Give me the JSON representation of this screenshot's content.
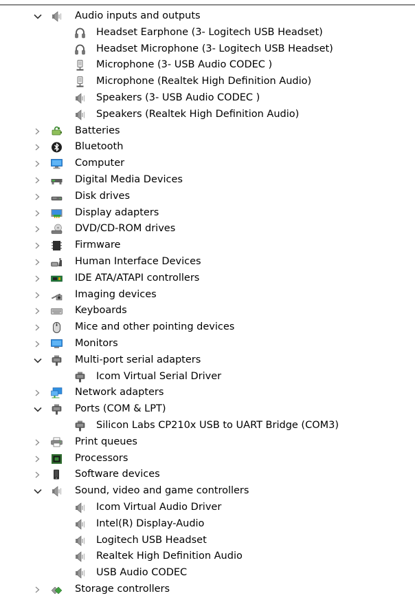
{
  "tree": [
    {
      "type": "category",
      "label": "Audio inputs and outputs",
      "expanded": true,
      "icon": "speaker-icon"
    },
    {
      "type": "device",
      "label": "Headset Earphone (3- Logitech USB Headset)",
      "icon": "headset-icon"
    },
    {
      "type": "device",
      "label": "Headset Microphone (3- Logitech USB Headset)",
      "icon": "headset-icon"
    },
    {
      "type": "device",
      "label": "Microphone (3- USB Audio CODEC )",
      "icon": "microphone-icon"
    },
    {
      "type": "device",
      "label": "Microphone (Realtek High Definition Audio)",
      "icon": "microphone-icon"
    },
    {
      "type": "device",
      "label": "Speakers (3- USB Audio CODEC )",
      "icon": "speaker-icon"
    },
    {
      "type": "device",
      "label": "Speakers (Realtek High Definition Audio)",
      "icon": "speaker-icon"
    },
    {
      "type": "category",
      "label": "Batteries",
      "expanded": false,
      "icon": "battery-icon"
    },
    {
      "type": "category",
      "label": "Bluetooth",
      "expanded": false,
      "icon": "bluetooth-icon"
    },
    {
      "type": "category",
      "label": "Computer",
      "expanded": false,
      "icon": "computer-icon"
    },
    {
      "type": "category",
      "label": "Digital Media Devices",
      "expanded": false,
      "icon": "media-device-icon"
    },
    {
      "type": "category",
      "label": "Disk drives",
      "expanded": false,
      "icon": "disk-drive-icon"
    },
    {
      "type": "category",
      "label": "Display adapters",
      "expanded": false,
      "icon": "display-adapter-icon"
    },
    {
      "type": "category",
      "label": "DVD/CD-ROM drives",
      "expanded": false,
      "icon": "dvd-drive-icon"
    },
    {
      "type": "category",
      "label": "Firmware",
      "expanded": false,
      "icon": "firmware-icon"
    },
    {
      "type": "category",
      "label": "Human Interface Devices",
      "expanded": false,
      "icon": "hid-icon"
    },
    {
      "type": "category",
      "label": "IDE ATA/ATAPI controllers",
      "expanded": false,
      "icon": "ide-controller-icon"
    },
    {
      "type": "category",
      "label": "Imaging devices",
      "expanded": false,
      "icon": "imaging-icon"
    },
    {
      "type": "category",
      "label": "Keyboards",
      "expanded": false,
      "icon": "keyboard-icon"
    },
    {
      "type": "category",
      "label": "Mice and other pointing devices",
      "expanded": false,
      "icon": "mouse-icon"
    },
    {
      "type": "category",
      "label": "Monitors",
      "expanded": false,
      "icon": "monitor-icon"
    },
    {
      "type": "category",
      "label": "Multi-port serial adapters",
      "expanded": true,
      "icon": "serial-port-icon"
    },
    {
      "type": "device",
      "label": "Icom Virtual Serial Driver",
      "icon": "serial-port-icon"
    },
    {
      "type": "category",
      "label": "Network adapters",
      "expanded": false,
      "icon": "network-adapter-icon"
    },
    {
      "type": "category",
      "label": "Ports (COM & LPT)",
      "expanded": true,
      "icon": "serial-port-icon"
    },
    {
      "type": "device",
      "label": "Silicon Labs CP210x USB to UART Bridge (COM3)",
      "icon": "serial-port-icon"
    },
    {
      "type": "category",
      "label": "Print queues",
      "expanded": false,
      "icon": "printer-icon"
    },
    {
      "type": "category",
      "label": "Processors",
      "expanded": false,
      "icon": "processor-icon"
    },
    {
      "type": "category",
      "label": "Software devices",
      "expanded": false,
      "icon": "software-device-icon"
    },
    {
      "type": "category",
      "label": "Sound, video and game controllers",
      "expanded": true,
      "icon": "speaker-icon"
    },
    {
      "type": "device",
      "label": "Icom Virtual Audio Driver",
      "icon": "speaker-icon"
    },
    {
      "type": "device",
      "label": "Intel(R) Display-Audio",
      "icon": "speaker-icon"
    },
    {
      "type": "device",
      "label": "Logitech USB Headset",
      "icon": "speaker-icon"
    },
    {
      "type": "device",
      "label": "Realtek High Definition Audio",
      "icon": "speaker-icon"
    },
    {
      "type": "device",
      "label": "USB Audio CODEC",
      "icon": "speaker-icon"
    },
    {
      "type": "category",
      "label": "Storage controllers",
      "expanded": false,
      "icon": "storage-controller-icon"
    }
  ]
}
